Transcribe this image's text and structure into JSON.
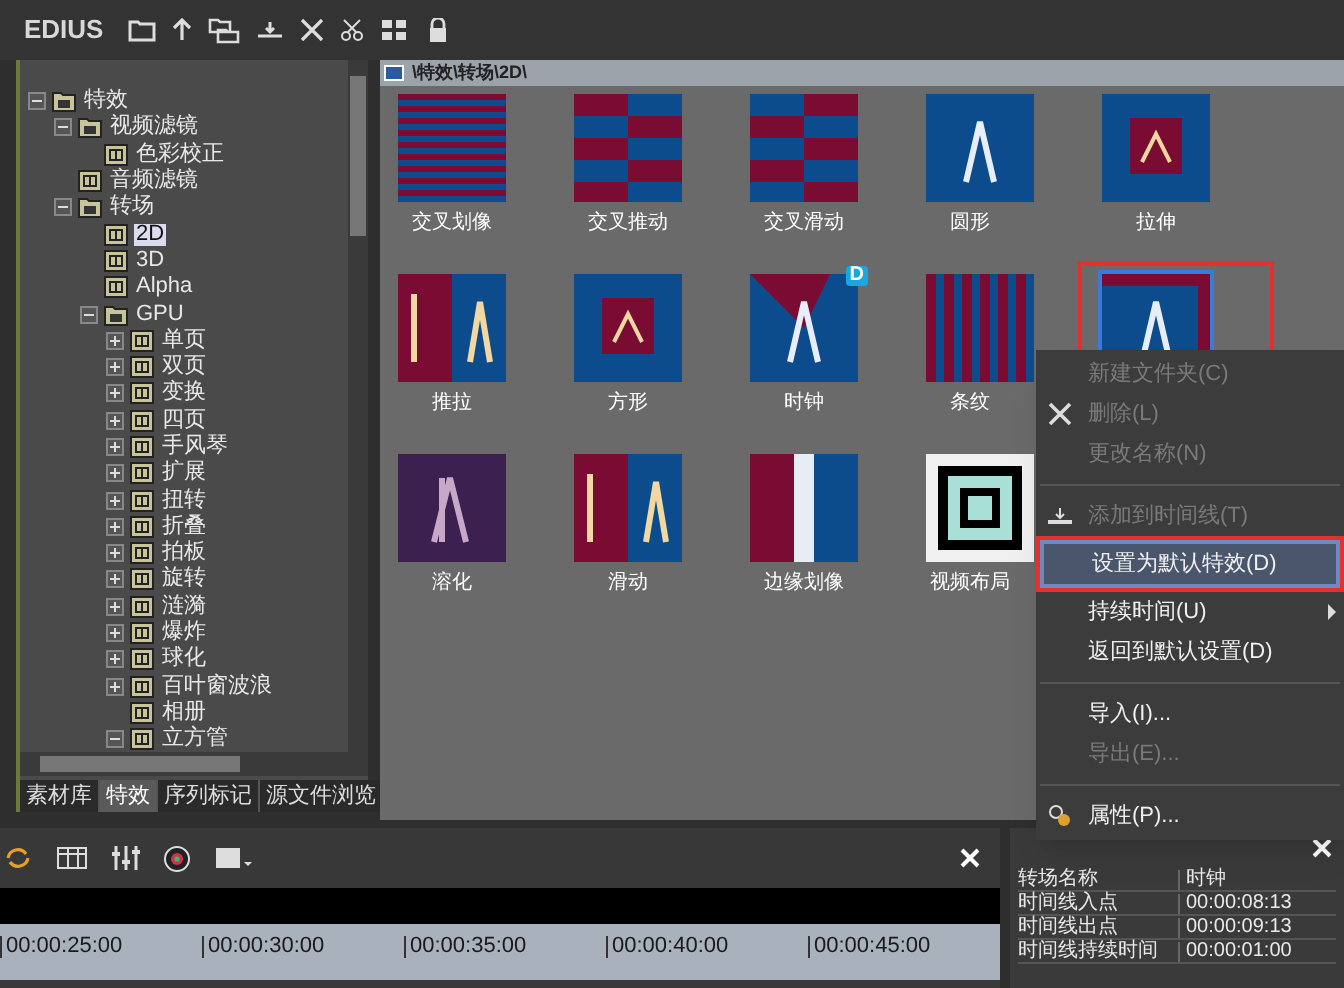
{
  "app": {
    "title": "EDIUS"
  },
  "tree": [
    {
      "label": "特效",
      "expanded": true,
      "children": [
        {
          "label": "视频滤镜",
          "expanded": true,
          "children": [
            {
              "label": "色彩校正",
              "selected": false
            }
          ]
        },
        {
          "label": "音频滤镜",
          "selected": false
        },
        {
          "label": "转场",
          "expanded": true,
          "children": [
            {
              "label": "2D",
              "selected": true
            },
            {
              "label": "3D",
              "selected": false
            },
            {
              "label": "Alpha",
              "selected": false
            },
            {
              "label": "GPU",
              "expanded": true,
              "children": [
                {
                  "label": "单页",
                  "expanded": false
                },
                {
                  "label": "双页",
                  "expanded": false
                },
                {
                  "label": "变换",
                  "expanded": false
                },
                {
                  "label": "四页",
                  "expanded": false
                },
                {
                  "label": "手风琴",
                  "expanded": false
                },
                {
                  "label": "扩展",
                  "expanded": false
                },
                {
                  "label": "扭转",
                  "expanded": false
                },
                {
                  "label": "折叠",
                  "expanded": false
                },
                {
                  "label": "拍板",
                  "expanded": false
                },
                {
                  "label": "旋转",
                  "expanded": false
                },
                {
                  "label": "涟漪",
                  "expanded": false
                },
                {
                  "label": "爆炸",
                  "expanded": false
                },
                {
                  "label": "球化",
                  "expanded": false
                },
                {
                  "label": "百叶窗波浪",
                  "expanded": false
                },
                {
                  "label": "相册",
                  "selected": false
                },
                {
                  "label": "立方管",
                  "expanded": true
                }
              ]
            }
          ]
        }
      ]
    }
  ],
  "bin_tabs": [
    {
      "label": "素材库",
      "selected": false
    },
    {
      "label": "特效",
      "selected": true
    },
    {
      "label": "序列标记",
      "selected": false
    },
    {
      "label": "源文件浏览",
      "selected": false
    }
  ],
  "path": "\\特效\\转场\\2D\\",
  "effects": [
    {
      "label": "交叉划像",
      "selected": false
    },
    {
      "label": "交叉推动",
      "selected": false
    },
    {
      "label": "交叉滑动",
      "selected": false
    },
    {
      "label": "圆形",
      "selected": false
    },
    {
      "label": "拉伸",
      "selected": false
    },
    {
      "label": "推拉",
      "selected": false
    },
    {
      "label": "方形",
      "selected": false
    },
    {
      "label": "时钟",
      "selected": false,
      "badge": "D"
    },
    {
      "label": "条纹",
      "selected": false
    },
    {
      "selected": true
    },
    {
      "label": "溶化",
      "selected": false
    },
    {
      "label": "滑动",
      "selected": false
    },
    {
      "label": "边缘划像",
      "selected": false
    },
    {
      "label": "视频布局",
      "selected": false
    }
  ],
  "context_menu": [
    {
      "kind": "item",
      "label": "新建文件夹(C)",
      "disabled": true,
      "selected": false
    },
    {
      "kind": "item",
      "label": "删除(L)",
      "disabled": true,
      "selected": false
    },
    {
      "kind": "item",
      "label": "更改名称(N)",
      "disabled": true,
      "selected": false
    },
    {
      "kind": "separator"
    },
    {
      "kind": "item",
      "label": "添加到时间线(T)",
      "disabled": true,
      "selected": false
    },
    {
      "kind": "item",
      "label": "设置为默认特效(D)",
      "disabled": false,
      "selected": true
    },
    {
      "kind": "item",
      "label": "持续时间(U)",
      "disabled": false,
      "selected": false,
      "submenu": true
    },
    {
      "kind": "item",
      "label": "返回到默认设置(D)",
      "disabled": false,
      "selected": false
    },
    {
      "kind": "separator"
    },
    {
      "kind": "item",
      "label": "导入(I)...",
      "disabled": false,
      "selected": false
    },
    {
      "kind": "item",
      "label": "导出(E)...",
      "disabled": true,
      "selected": false
    },
    {
      "kind": "separator"
    },
    {
      "kind": "item",
      "label": "属性(P)...",
      "disabled": false,
      "selected": false
    }
  ],
  "timeline": {
    "ruler": [
      "00:00:25:00",
      "00:00:30:00",
      "00:00:35:00",
      "00:00:40:00",
      "00:00:45:00"
    ]
  },
  "info_panel": {
    "rows": [
      {
        "name": "转场名称",
        "value": "时钟"
      },
      {
        "name": "时间线入点",
        "value": "00:00:08:13"
      },
      {
        "name": "时间线出点",
        "value": "00:00:09:13"
      },
      {
        "name": "时间线持续时间",
        "value": "00:00:01:00"
      }
    ]
  }
}
